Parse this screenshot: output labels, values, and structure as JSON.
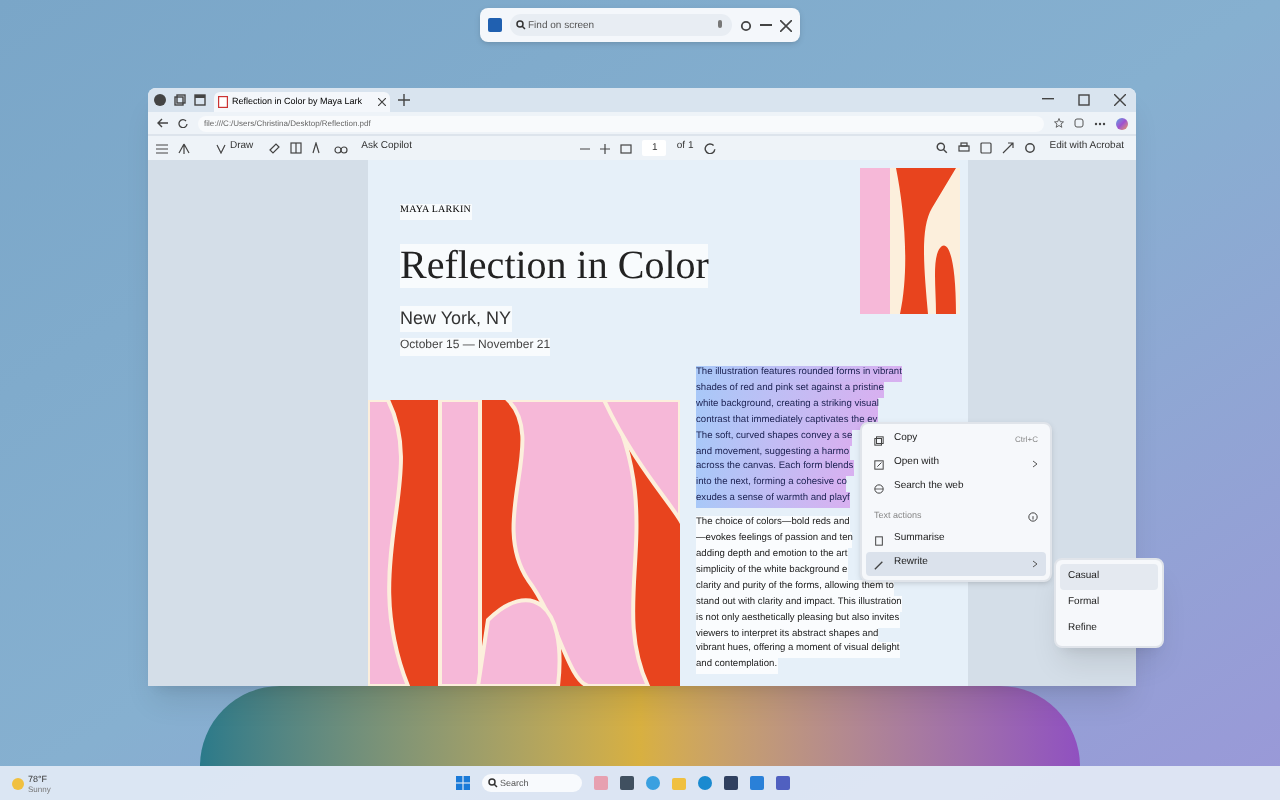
{
  "find_bar": {
    "placeholder": "Find on screen"
  },
  "browser": {
    "tab": {
      "title": "Reflection in Color by Maya Lark",
      "selected": true
    },
    "address": "file:///C:/Users/Christina/Desktop/Reflection.pdf",
    "toolbar": {
      "draw": "Draw",
      "ask_copilot": "Ask Copilot",
      "page": "1",
      "page_count": "of 1",
      "edit": "Edit with Acrobat"
    }
  },
  "document": {
    "author": "MAYA LARKIN",
    "title": "Reflection in Color",
    "location": "New York, NY",
    "dates": "October 15 — November 21",
    "selected_text": [
      "The illustration features rounded forms in vibrant",
      "shades of red and pink set against a pristine",
      "white background, creating a striking visual",
      "contrast that immediately captivates the ey",
      "The soft, curved shapes convey a se",
      "and movement, suggesting a harmo",
      "across the canvas. Each form blends",
      "into the next, forming a cohesive co",
      "exudes a sense of warmth and playf"
    ],
    "body_text": [
      "The choice of colors—bold reds and",
      "—evokes feelings of passion and ten",
      "adding depth and emotion to the art",
      "simplicity of the white background e",
      "clarity and purity of the forms, allowing them to",
      "stand out with clarity and impact. This illustration",
      "is not only aesthetically pleasing but also invites",
      "viewers to interpret its abstract shapes and",
      "vibrant hues, offering a moment of visual delight",
      "and contemplation."
    ]
  },
  "context_menu": {
    "items": [
      {
        "kind": "item",
        "label": "Copy",
        "shortcut": "Ctrl+C",
        "has_submenu": false,
        "selected": false
      },
      {
        "kind": "item",
        "label": "Open with",
        "has_submenu": true,
        "selected": false
      },
      {
        "kind": "item",
        "label": "Search the web",
        "has_submenu": false,
        "selected": false
      },
      {
        "kind": "header",
        "label": "Text actions"
      },
      {
        "kind": "item",
        "label": "Summarise",
        "has_submenu": false,
        "selected": false
      },
      {
        "kind": "item",
        "label": "Rewrite",
        "has_submenu": true,
        "selected": true
      }
    ]
  },
  "submenu": {
    "items": [
      {
        "label": "Casual",
        "selected": true
      },
      {
        "label": "Formal",
        "selected": false
      },
      {
        "label": "Refine",
        "selected": false
      }
    ]
  },
  "taskbar": {
    "weather": {
      "temperature": "78°F",
      "condition": "Sunny"
    },
    "search": {
      "placeholder": "Search"
    }
  }
}
